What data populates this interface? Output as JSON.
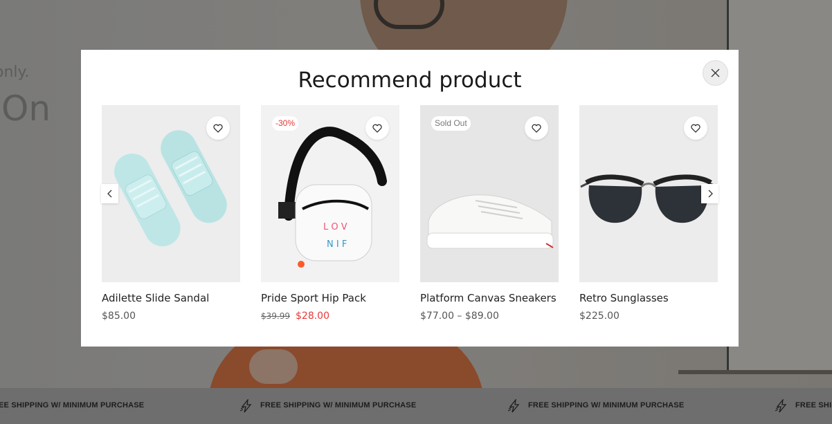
{
  "background": {
    "hero_text_top": "only.",
    "hero_text_large": "On",
    "marquee_items": [
      "EE SHIPPING W/ MINIMUM PURCHASE",
      "FREE SHIPPING W/ MINIMUM PURCHASE",
      "FREE SHIPPING W/ MINIMUM PURCHASE",
      "FREE SHIPPING W/ MINIMUM PURCHASE",
      "FREE SHIPP"
    ],
    "marquee_icon": "lightning-icon"
  },
  "modal": {
    "title": "Recommend product",
    "close_icon": "close-icon",
    "prev_icon": "chevron-left-icon",
    "next_icon": "chevron-right-icon",
    "wishlist_icon": "heart-icon",
    "accent_sale_color": "#e53935",
    "products": [
      {
        "name": "Adilette Slide Sandal",
        "price": "$85.00",
        "badge": ""
      },
      {
        "name": "Pride Sport Hip Pack",
        "old_price": "$39.99",
        "sale_price": "$28.00",
        "badge": "-30%"
      },
      {
        "name": "Platform Canvas Sneakers",
        "price": "$77.00 – $89.00",
        "badge": "Sold Out"
      },
      {
        "name": "Retro Sunglasses",
        "price": "$225.00",
        "badge": ""
      }
    ]
  }
}
